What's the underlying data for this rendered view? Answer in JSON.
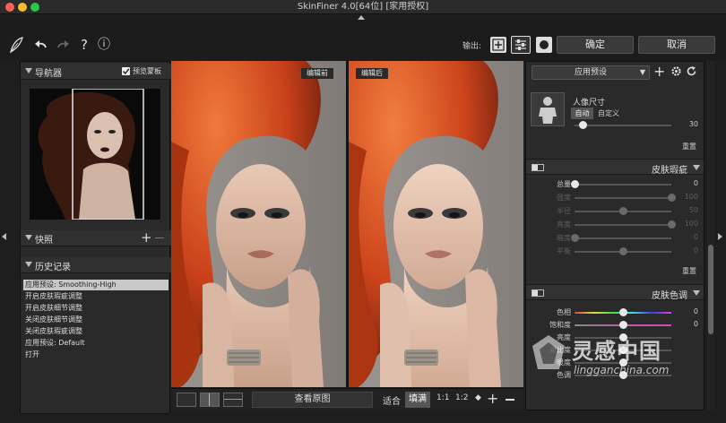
{
  "window": {
    "title": "SkinFiner 4.0[64位] [家用授权]"
  },
  "toolbar": {
    "output_label": "输出:",
    "ok_label": "确定",
    "cancel_label": "取消",
    "help_glyph": "?",
    "info_glyph": "ⓘ"
  },
  "navigator": {
    "title": "导航器",
    "preview_mask_label": "预览蒙板",
    "preview_mask_checked": true
  },
  "snapshot": {
    "title": "快照"
  },
  "history": {
    "title": "历史记录",
    "items": [
      "应用预设: Smoothing-High",
      "开启皮肤瑕疵调整",
      "开启皮肤细节调整",
      "关闭皮肤细节调整",
      "关闭皮肤瑕疵调整",
      "应用预设: Default",
      "打开"
    ],
    "selected_index": 0
  },
  "viewer": {
    "before_label": "编辑前",
    "after_label": "编辑后"
  },
  "bottombar": {
    "view_original": "查看原图",
    "fit": "适合",
    "fill": "填满",
    "zoom_1_1": "1:1",
    "zoom_1_2": "1:2"
  },
  "right_panel": {
    "preset_label": "应用预设",
    "portrait": {
      "title": "人像尺寸",
      "auto": "自动",
      "custom": "自定义",
      "value": "30",
      "level": 0.08,
      "reset": "重置"
    },
    "blemish": {
      "title": "皮肤瑕疵",
      "reset": "重置",
      "rows": [
        {
          "label": "总量",
          "value": "0",
          "level": 0.0,
          "dim": false
        },
        {
          "label": "强度",
          "value": "100",
          "level": 1.0,
          "dim": true
        },
        {
          "label": "半径",
          "value": "50",
          "level": 0.5,
          "dim": true
        },
        {
          "label": "亮度",
          "value": "100",
          "level": 1.0,
          "dim": true
        },
        {
          "label": "暗度",
          "value": "0",
          "level": 0.0,
          "dim": true
        },
        {
          "label": "平衡",
          "value": "0",
          "level": 0.5,
          "dim": true
        }
      ]
    },
    "tone": {
      "title": "皮肤色调",
      "rows": [
        {
          "label": "色相",
          "value": "0",
          "level": 0.5,
          "dim": false
        },
        {
          "label": "饱和度",
          "value": "0",
          "level": 0.5,
          "dim": false
        },
        {
          "label": "亮度",
          "value": "",
          "level": 0.5,
          "dim": false
        },
        {
          "label": "对比度",
          "value": "",
          "level": 0.5,
          "dim": false
        },
        {
          "label": "暖度",
          "value": "",
          "level": 0.5,
          "dim": false
        },
        {
          "label": "色调",
          "value": "",
          "level": 0.5,
          "dim": false
        }
      ]
    }
  },
  "watermark": {
    "brand_cn": "灵感中国",
    "brand_url": "lingganchina.com"
  },
  "colors": {
    "accent": "#e8e8e8",
    "panel": "#2a2a2a",
    "hair": "#d4481a"
  }
}
